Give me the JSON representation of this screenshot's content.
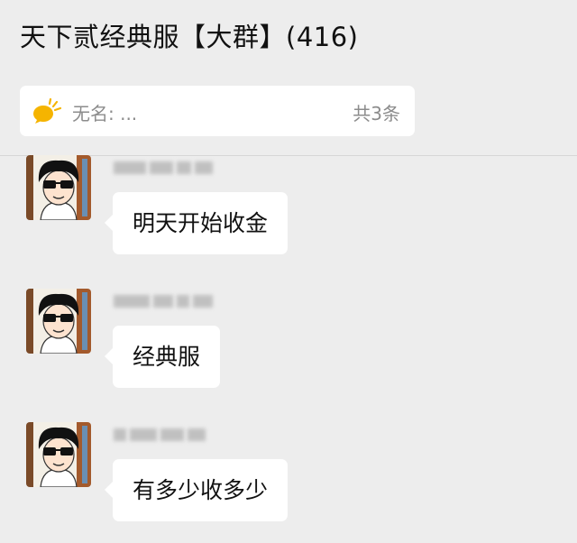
{
  "header": {
    "title": "天下贰经典服【大群】(416)"
  },
  "notice": {
    "icon": "megaphone-icon",
    "text": "无名: ...",
    "count": "共3条",
    "accent_color": "#f5b400"
  },
  "messages": [
    {
      "text": "明天开始收金"
    },
    {
      "text": "经典服"
    },
    {
      "text": "有多少收多少"
    }
  ]
}
